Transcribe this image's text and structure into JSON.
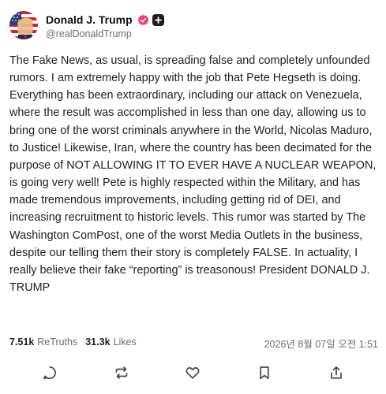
{
  "author": {
    "display_name": "Donald J. Trump",
    "handle": "@realDonaldTrump",
    "verified_icon": "verified-check-icon",
    "badge_icon": "plus-badge-icon",
    "verified_color": "#e8437a"
  },
  "post": {
    "text": "The Fake News, as usual, is spreading false and completely unfounded rumors. I am extremely happy with the job that Pete Hegseth is doing. Everything has been extraordinary, including our attack on Venezuela, where the result was accomplished in less than one day, allowing us to bring one of the worst criminals anywhere in the World, Nicolas Maduro, to Justice! Likewise, Iran, where the country has been decimated for the purpose of NOT ALLOWING IT TO EVER HAVE A NUCLEAR WEAPON, is going very well! Pete is highly respected within the Military, and has made tremendous improvements, including getting rid of DEI, and increasing recruitment to historic levels. This rumor was started by The Washington ComPost, one of the worst Media Outlets in the business, despite our telling them their story is completely FALSE. In actuality, I really believe their fake “reporting” is treasonous! President DONALD J. TRUMP"
  },
  "stats": {
    "retruths_count": "7.51k",
    "retruths_label": "ReTruths",
    "likes_count": "31.3k",
    "likes_label": "Likes",
    "timestamp": "2026년 8월 07일 오전 1:51"
  },
  "actions": [
    {
      "name": "reply-icon"
    },
    {
      "name": "retruth-icon"
    },
    {
      "name": "like-icon"
    },
    {
      "name": "bookmark-icon"
    },
    {
      "name": "share-icon"
    }
  ]
}
